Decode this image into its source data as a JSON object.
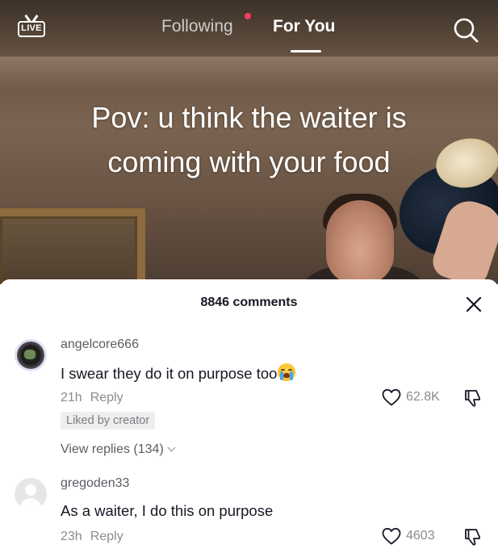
{
  "topbar": {
    "live_label": "LIVE",
    "tab_following": "Following",
    "tab_for_you": "For You"
  },
  "video": {
    "caption_line1": "Pov: u think the waiter is",
    "caption_line2": "coming with your food"
  },
  "comments_panel": {
    "header": "8846 comments",
    "comments": [
      {
        "username": "angelcore666",
        "text": "I swear they do it on purpose too",
        "emoji": "loudly-crying-face",
        "time": "21h",
        "reply_label": "Reply",
        "liked_by_creator": "Liked by creator",
        "likes": "62.8K",
        "view_replies": "View replies (134)"
      },
      {
        "username": "gregoden33",
        "text": "As a waiter, I do this on purpose",
        "time": "23h",
        "reply_label": "Reply",
        "likes": "4603"
      }
    ]
  },
  "icons": {
    "live": "live-icon",
    "search": "search-icon",
    "close": "close-icon",
    "like": "heart-icon",
    "dislike": "dislike-icon"
  },
  "colors": {
    "notification_dot": "#f43f5e",
    "primary_text": "#161823",
    "secondary_text": "#8a8b91"
  }
}
